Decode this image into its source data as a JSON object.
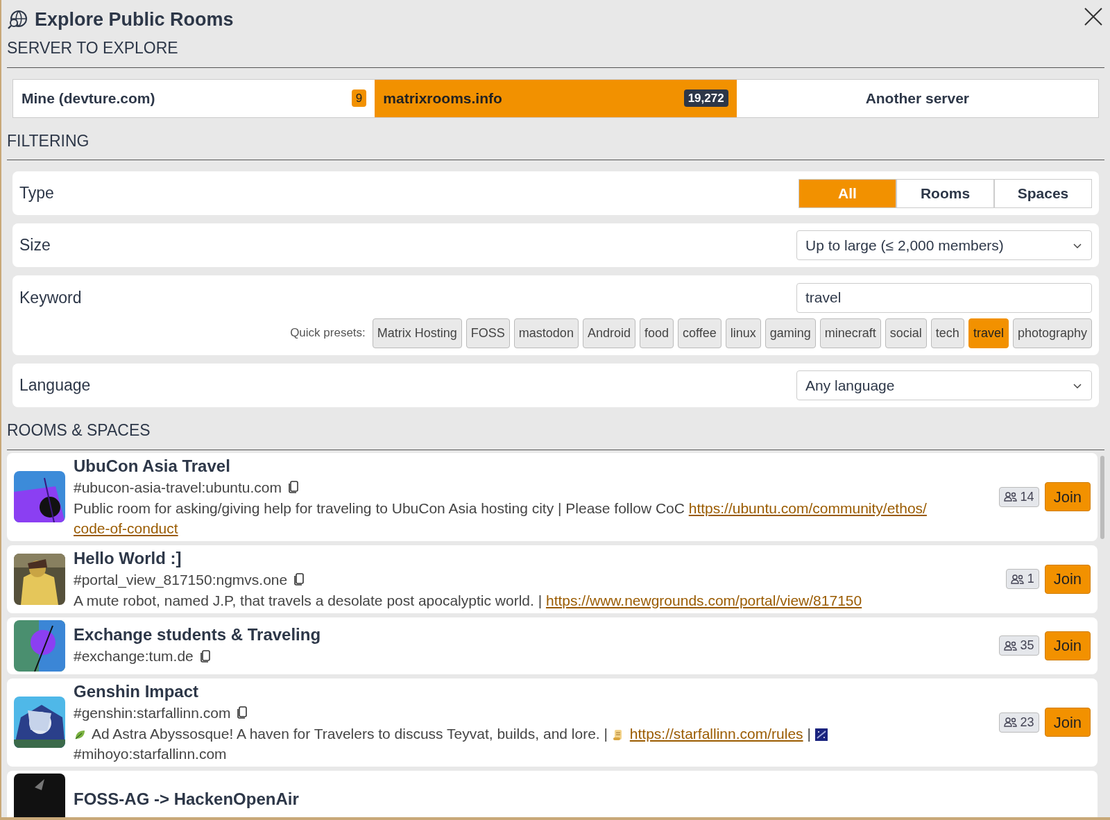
{
  "dialog": {
    "title": "Explore Public Rooms"
  },
  "server_section": {
    "heading": "SERVER TO EXPLORE",
    "servers": [
      {
        "label": "Mine (devture.com)",
        "count": "9",
        "selected": false
      },
      {
        "label": "matrixrooms.info",
        "count": "19,272",
        "selected": true
      },
      {
        "label": "Another server",
        "selected": false
      }
    ]
  },
  "filtering": {
    "heading": "FILTERING",
    "type": {
      "label": "Type",
      "options": [
        {
          "label": "All",
          "selected": true
        },
        {
          "label": "Rooms",
          "selected": false
        },
        {
          "label": "Spaces",
          "selected": false
        }
      ]
    },
    "size": {
      "label": "Size",
      "value": "Up to large (≤ 2,000 members)"
    },
    "keyword": {
      "label": "Keyword",
      "value": "travel",
      "presets_label": "Quick presets:",
      "presets": [
        {
          "label": "Matrix Hosting",
          "selected": false
        },
        {
          "label": "FOSS",
          "selected": false
        },
        {
          "label": "mastodon",
          "selected": false
        },
        {
          "label": "Android",
          "selected": false
        },
        {
          "label": "food",
          "selected": false
        },
        {
          "label": "coffee",
          "selected": false
        },
        {
          "label": "linux",
          "selected": false
        },
        {
          "label": "gaming",
          "selected": false
        },
        {
          "label": "minecraft",
          "selected": false
        },
        {
          "label": "social",
          "selected": false
        },
        {
          "label": "tech",
          "selected": false
        },
        {
          "label": "travel",
          "selected": true
        },
        {
          "label": "photography",
          "selected": false
        }
      ]
    },
    "language": {
      "label": "Language",
      "value": "Any language"
    }
  },
  "rooms": {
    "heading": "ROOMS & SPACES",
    "items": [
      {
        "name": "UbuCon Asia Travel",
        "alias": "#ubucon-asia-travel:ubuntu.com",
        "members": "14",
        "join": "Join",
        "description": [
          {
            "kind": "text",
            "text": "Public room for asking/giving help for traveling to UbuCon Asia hosting city | Please follow CoC "
          },
          {
            "kind": "link",
            "text": "https://ubuntu.com/community/ethos/"
          },
          {
            "kind": "link",
            "text": "code-of-conduct"
          }
        ]
      },
      {
        "name": "Hello World :]",
        "alias": "#portal_view_817150:ngmvs.one",
        "members": "1",
        "join": "Join",
        "description": [
          {
            "kind": "text",
            "text": "A mute robot, named J.P, that travels a desolate post apocalyptic world. | "
          },
          {
            "kind": "link",
            "text": "https://www.newgrounds.com/portal/view/817150"
          }
        ]
      },
      {
        "name": "Exchange students & Traveling",
        "alias": "#exchange:tum.de",
        "members": "35",
        "join": "Join"
      },
      {
        "name": "Genshin Impact",
        "alias": "#genshin:starfallinn.com",
        "members": "23",
        "join": "Join",
        "description": [
          {
            "kind": "emoji"
          },
          {
            "kind": "text",
            "text": "Ad Astra Abyssosque! A haven for Travelers to discuss Teyvat, builds, and lore. | "
          },
          {
            "kind": "emoji"
          },
          {
            "kind": "link",
            "text": "https://starfallinn.com/rules"
          },
          {
            "kind": "text",
            "text": " | "
          },
          {
            "kind": "emoji"
          },
          {
            "kind": "text",
            "text": "#mihoyo:starfallinn.com"
          }
        ]
      },
      {
        "name": "FOSS-AG -> HackenOpenAir"
      }
    ]
  }
}
